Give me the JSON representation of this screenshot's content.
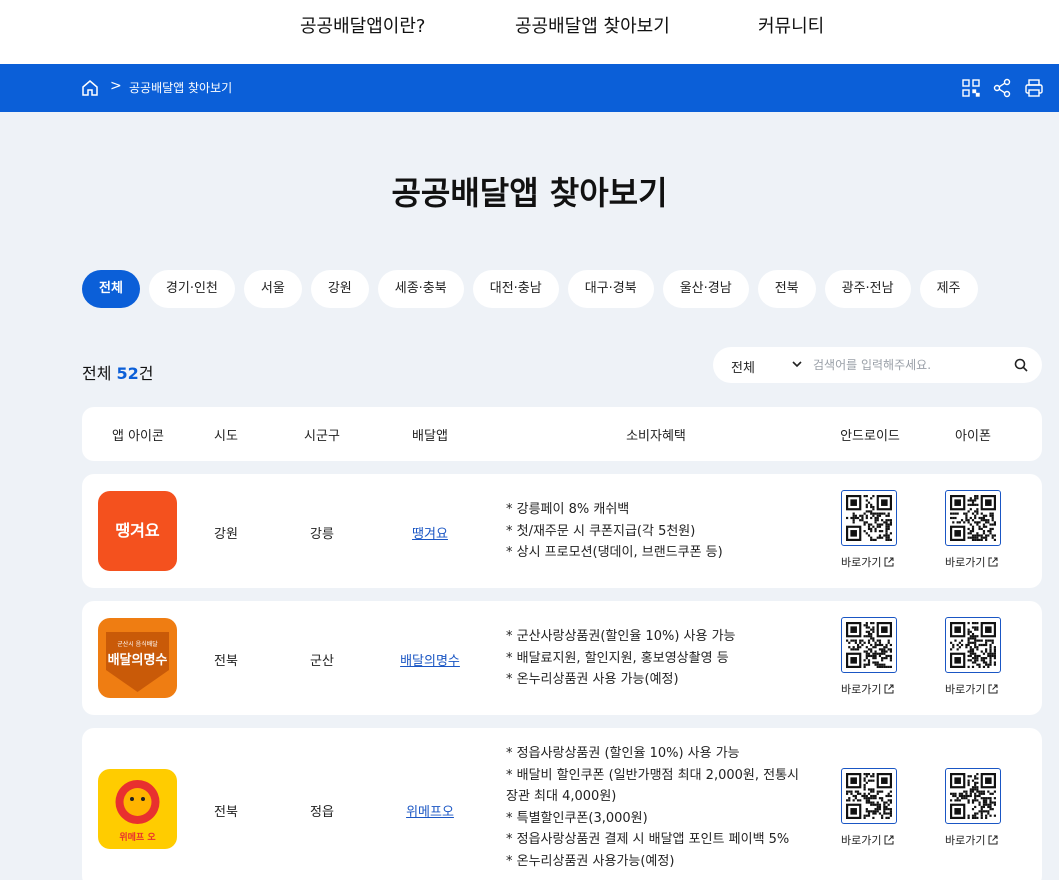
{
  "nav": {
    "items": [
      "공공배달앱이란?",
      "공공배달앱 찾아보기",
      "커뮤니티"
    ]
  },
  "breadcrumb": {
    "separator": ">",
    "current": "공공배달앱 찾아보기"
  },
  "page": {
    "title": "공공배달앱 찾아보기"
  },
  "regions": [
    "전체",
    "경기·인천",
    "서울",
    "강원",
    "세종·충북",
    "대전·충남",
    "대구·경북",
    "울산·경남",
    "전북",
    "광주·전남",
    "제주"
  ],
  "count": {
    "prefix": "전체 ",
    "value": "52",
    "suffix": "건"
  },
  "search": {
    "selected": "전체",
    "placeholder": "검색어를 입력해주세요."
  },
  "table": {
    "headers": [
      "앱 아이콘",
      "시도",
      "시군구",
      "배달앱",
      "소비자혜택",
      "안드로이드",
      "아이폰"
    ],
    "go_label": "바로가기",
    "rows": [
      {
        "sido": "강원",
        "sigungu": "강릉",
        "app": "땡겨요",
        "icon_text": "땡겨요",
        "benefits": [
          "* 강릉페이 8% 캐쉬백",
          "* 첫/재주문 시 쿠폰지급(각 5천원)",
          "* 상시 프로모션(댕데이, 브랜드쿠폰 등)"
        ]
      },
      {
        "sido": "전북",
        "sigungu": "군산",
        "app": "배달의명수",
        "icon_text": "배달의명수",
        "icon_subtext": "군산시 음식배달",
        "benefits": [
          "* 군산사랑상품권(할인율 10%) 사용 가능",
          "* 배달료지원, 할인지원, 홍보영상촬영 등",
          "* 온누리상품권 사용 가능(예정)"
        ]
      },
      {
        "sido": "전북",
        "sigungu": "정읍",
        "app": "위메프오",
        "icon_text": "위메프 오",
        "benefits": [
          "* 정읍사랑상품권 (할인율 10%) 사용 가능",
          "* 배달비 할인쿠폰 (일반가맹점 최대 2,000원, 전통시",
          "장관 최대 4,000원)",
          "* 특별할인쿠폰(3,000원)",
          "* 정읍사랑상품권 결제 시 배달앱 포인트 페이백 5%",
          "* 온누리상품권 사용가능(예정)"
        ]
      }
    ]
  },
  "colors": {
    "primary": "#0b5fd8",
    "background": "#eef2f7",
    "link": "#1a56c4"
  }
}
